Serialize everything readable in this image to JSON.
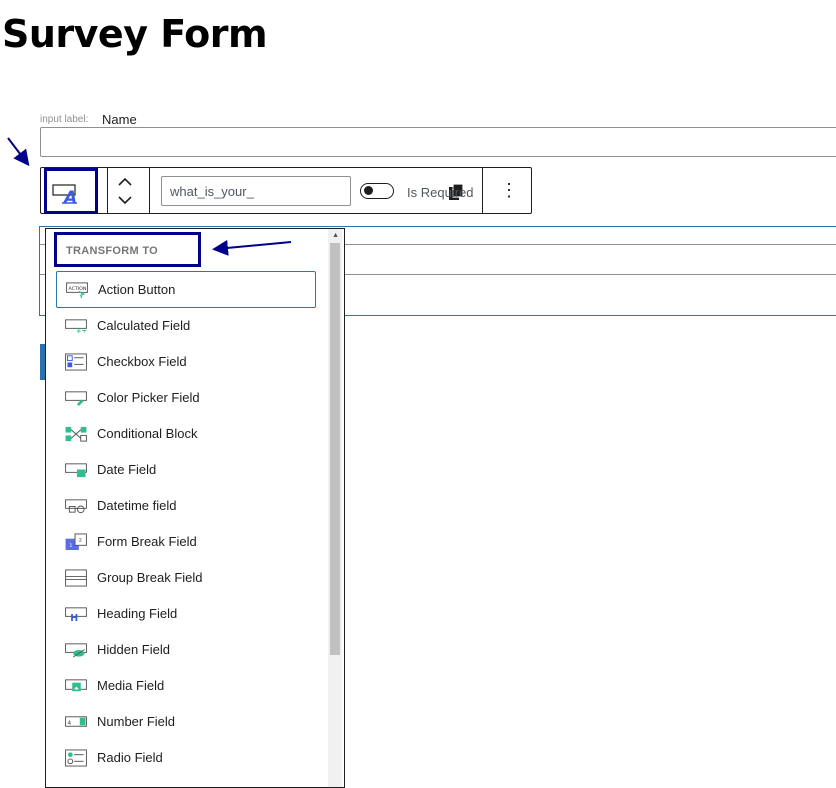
{
  "page": {
    "title": "Survey Form"
  },
  "field": {
    "input_label_caption": "input label:",
    "input_label_value": "Name"
  },
  "toolbar": {
    "name_attr_value": "what_is_your_",
    "required_label": "Is Required"
  },
  "dropdown": {
    "header": "TRANSFORM TO",
    "items": [
      {
        "label": "Action Button",
        "icon": "action-button-icon"
      },
      {
        "label": "Calculated Field",
        "icon": "calculated-field-icon"
      },
      {
        "label": "Checkbox Field",
        "icon": "checkbox-field-icon"
      },
      {
        "label": "Color Picker Field",
        "icon": "color-picker-field-icon"
      },
      {
        "label": "Conditional Block",
        "icon": "conditional-block-icon"
      },
      {
        "label": "Date Field",
        "icon": "date-field-icon"
      },
      {
        "label": "Datetime field",
        "icon": "datetime-field-icon"
      },
      {
        "label": "Form Break Field",
        "icon": "form-break-field-icon"
      },
      {
        "label": "Group Break Field",
        "icon": "group-break-field-icon"
      },
      {
        "label": "Heading Field",
        "icon": "heading-field-icon"
      },
      {
        "label": "Hidden Field",
        "icon": "hidden-field-icon"
      },
      {
        "label": "Media Field",
        "icon": "media-field-icon"
      },
      {
        "label": "Number Field",
        "icon": "number-field-icon"
      },
      {
        "label": "Radio Field",
        "icon": "radio-field-icon"
      }
    ]
  },
  "colors": {
    "accent": "#2a75b3",
    "annotation": "#00008b",
    "icon_teal": "#2fbf8f"
  }
}
